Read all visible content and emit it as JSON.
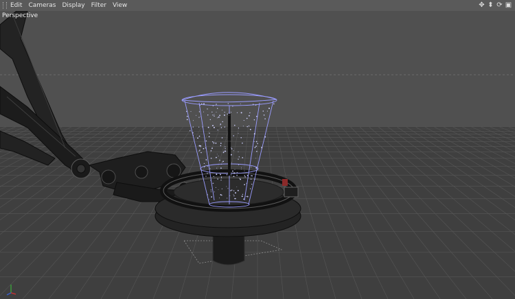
{
  "menubar": {
    "items": [
      {
        "id": "edit",
        "label": "Edit"
      },
      {
        "id": "cameras",
        "label": "Cameras"
      },
      {
        "id": "display",
        "label": "Display"
      },
      {
        "id": "filter",
        "label": "Filter"
      },
      {
        "id": "view",
        "label": "View"
      }
    ],
    "nav_icons": [
      "move-view-icon",
      "dolly-view-icon",
      "rotate-view-icon",
      "toggle-layout-icon"
    ]
  },
  "viewport": {
    "label": "Perspective",
    "colors": {
      "sky": "#505050",
      "floor": "#3f3f3f",
      "grid": "#5a5a5a",
      "particle_emitter": "#9a9cff",
      "model": "#1a1a1a"
    }
  }
}
